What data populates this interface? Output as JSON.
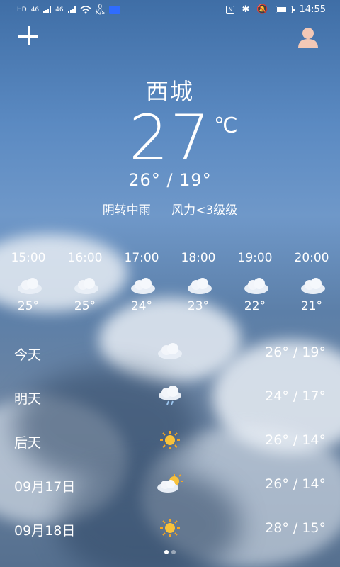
{
  "status_bar": {
    "hd1": "HD",
    "hd2": "HD",
    "net1": "46",
    "net2": "46",
    "speed": "0",
    "speed_unit": "K/s",
    "time": "14:55",
    "battery_level": 0.7,
    "icons": [
      "nfc-icon",
      "bluetooth-icon",
      "mute-icon",
      "battery-icon"
    ]
  },
  "header": {
    "add_icon": "plus-icon",
    "profile_icon": "person-icon"
  },
  "current": {
    "city": "西城",
    "temp": "27",
    "unit": "℃",
    "range": "26° / 19°",
    "condition": "阴转中雨",
    "wind": "风力<3级级"
  },
  "hourly": [
    {
      "time": "15:00",
      "icon": "cloud-icon",
      "temp": "25°"
    },
    {
      "time": "16:00",
      "icon": "cloud-icon",
      "temp": "25°"
    },
    {
      "time": "17:00",
      "icon": "cloud-icon",
      "temp": "24°"
    },
    {
      "time": "18:00",
      "icon": "cloud-icon",
      "temp": "23°"
    },
    {
      "time": "19:00",
      "icon": "cloud-icon",
      "temp": "22°"
    },
    {
      "time": "20:00",
      "icon": "cloud-icon",
      "temp": "21°"
    }
  ],
  "daily": [
    {
      "day": "今天",
      "icon": "cloud-icon",
      "range": "26° / 19°"
    },
    {
      "day": "明天",
      "icon": "rain-icon",
      "range": "24° / 17°"
    },
    {
      "day": "后天",
      "icon": "sun-icon",
      "range": "26° / 14°"
    },
    {
      "day": "09月17日",
      "icon": "partly-cloudy-icon",
      "range": "26° / 14°"
    },
    {
      "day": "09月18日",
      "icon": "sun-icon",
      "range": "28° / 15°"
    }
  ],
  "pager": {
    "count": 2,
    "active": 0
  }
}
